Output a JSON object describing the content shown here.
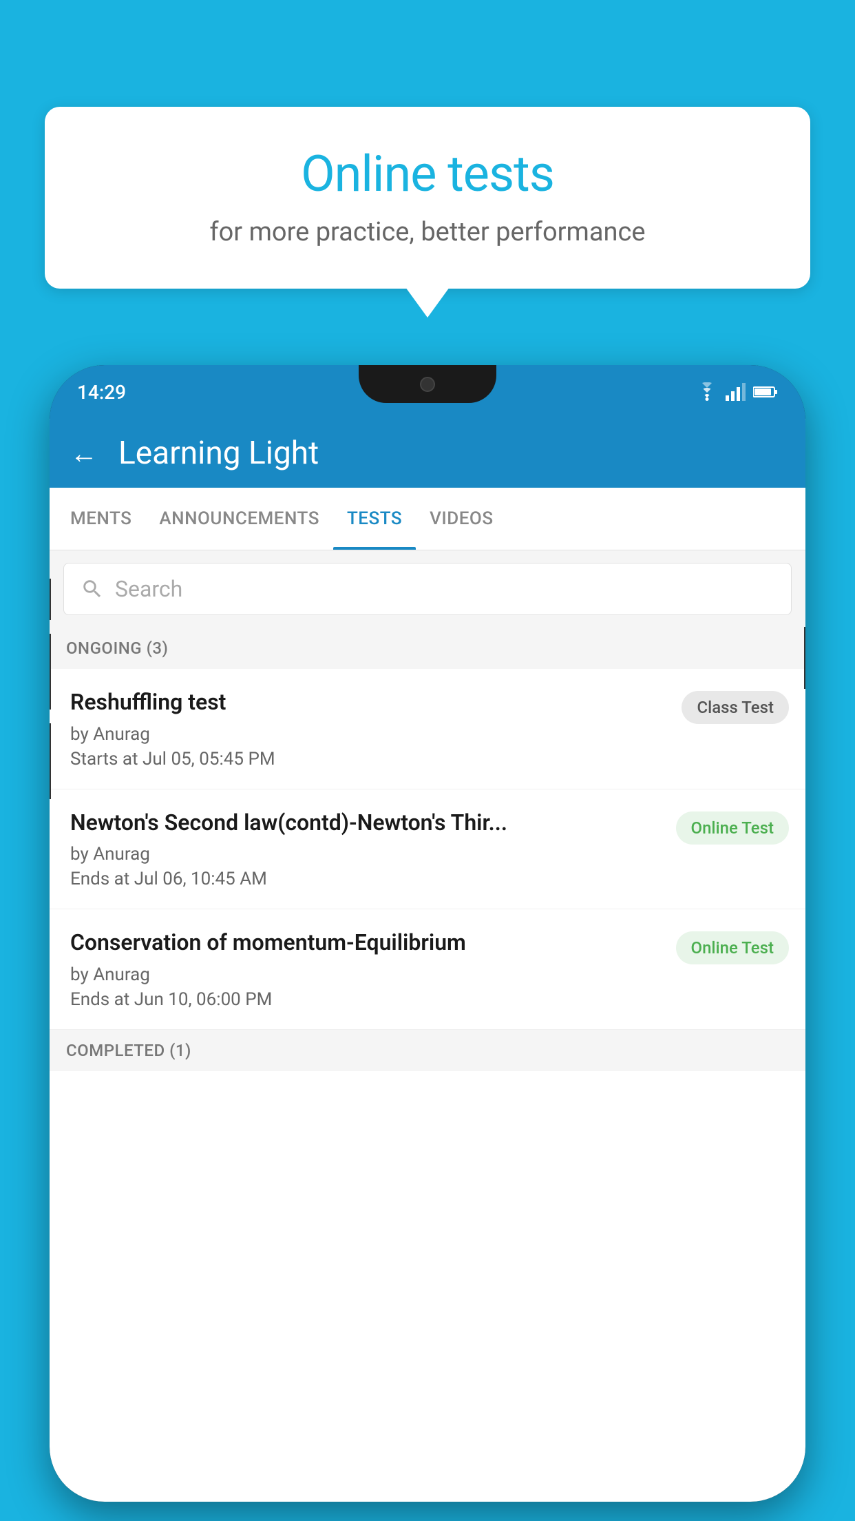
{
  "background_color": "#1ab3e0",
  "speech_bubble": {
    "title": "Online tests",
    "subtitle": "for more practice, better performance"
  },
  "phone": {
    "status_bar": {
      "time": "14:29"
    },
    "app_header": {
      "title": "Learning Light",
      "back_label": "←"
    },
    "tabs": [
      {
        "label": "MENTS",
        "active": false
      },
      {
        "label": "ANNOUNCEMENTS",
        "active": false
      },
      {
        "label": "TESTS",
        "active": true
      },
      {
        "label": "VIDEOS",
        "active": false
      }
    ],
    "search": {
      "placeholder": "Search"
    },
    "ongoing_section": {
      "label": "ONGOING (3)"
    },
    "test_items": [
      {
        "title": "Reshuffling test",
        "author": "by Anurag",
        "date": "Starts at  Jul 05, 05:45 PM",
        "badge": "Class Test",
        "badge_type": "class"
      },
      {
        "title": "Newton's Second law(contd)-Newton's Thir...",
        "author": "by Anurag",
        "date": "Ends at  Jul 06, 10:45 AM",
        "badge": "Online Test",
        "badge_type": "online"
      },
      {
        "title": "Conservation of momentum-Equilibrium",
        "author": "by Anurag",
        "date": "Ends at  Jun 10, 06:00 PM",
        "badge": "Online Test",
        "badge_type": "online"
      }
    ],
    "completed_section": {
      "label": "COMPLETED (1)"
    }
  }
}
